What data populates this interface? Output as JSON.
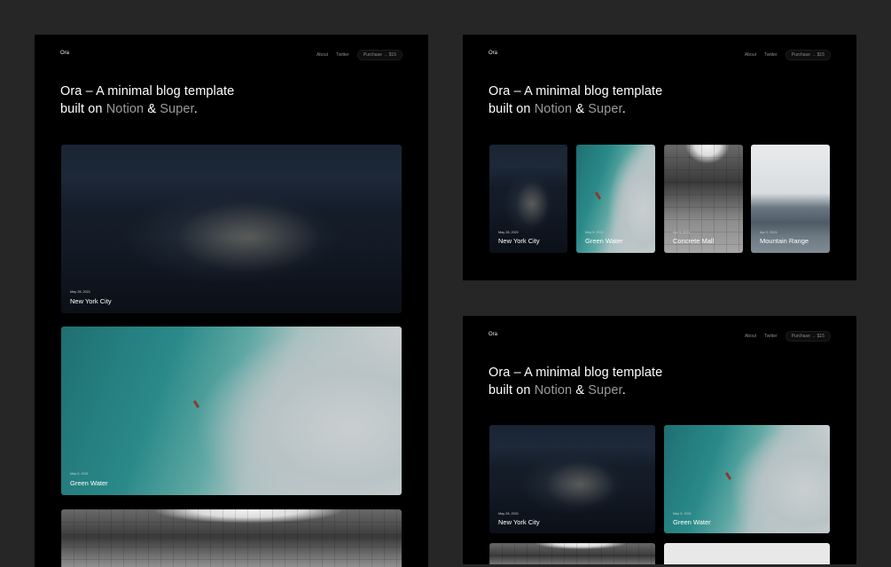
{
  "brand": "Ora",
  "nav": {
    "about": "About",
    "twitter": "Twitter",
    "purchase": "Purchase → $15"
  },
  "headline": {
    "line1": "Ora – A minimal blog template",
    "built_on": "built on",
    "notion": "Notion",
    "amp": "&",
    "super": "Super",
    "period": "."
  },
  "posts": [
    {
      "date": "May 28, 2021",
      "title": "New York City"
    },
    {
      "date": "May 5, 2021",
      "title": "Green Water"
    },
    {
      "date": "Apr 9, 2021",
      "title": "Concrete Mall"
    },
    {
      "date": "Apr 2, 2021",
      "title": "Mountain Range"
    }
  ],
  "colors": {
    "page_bg": "#262626",
    "panel_bg": "#000000",
    "accent_text": "#9a9a9a"
  }
}
